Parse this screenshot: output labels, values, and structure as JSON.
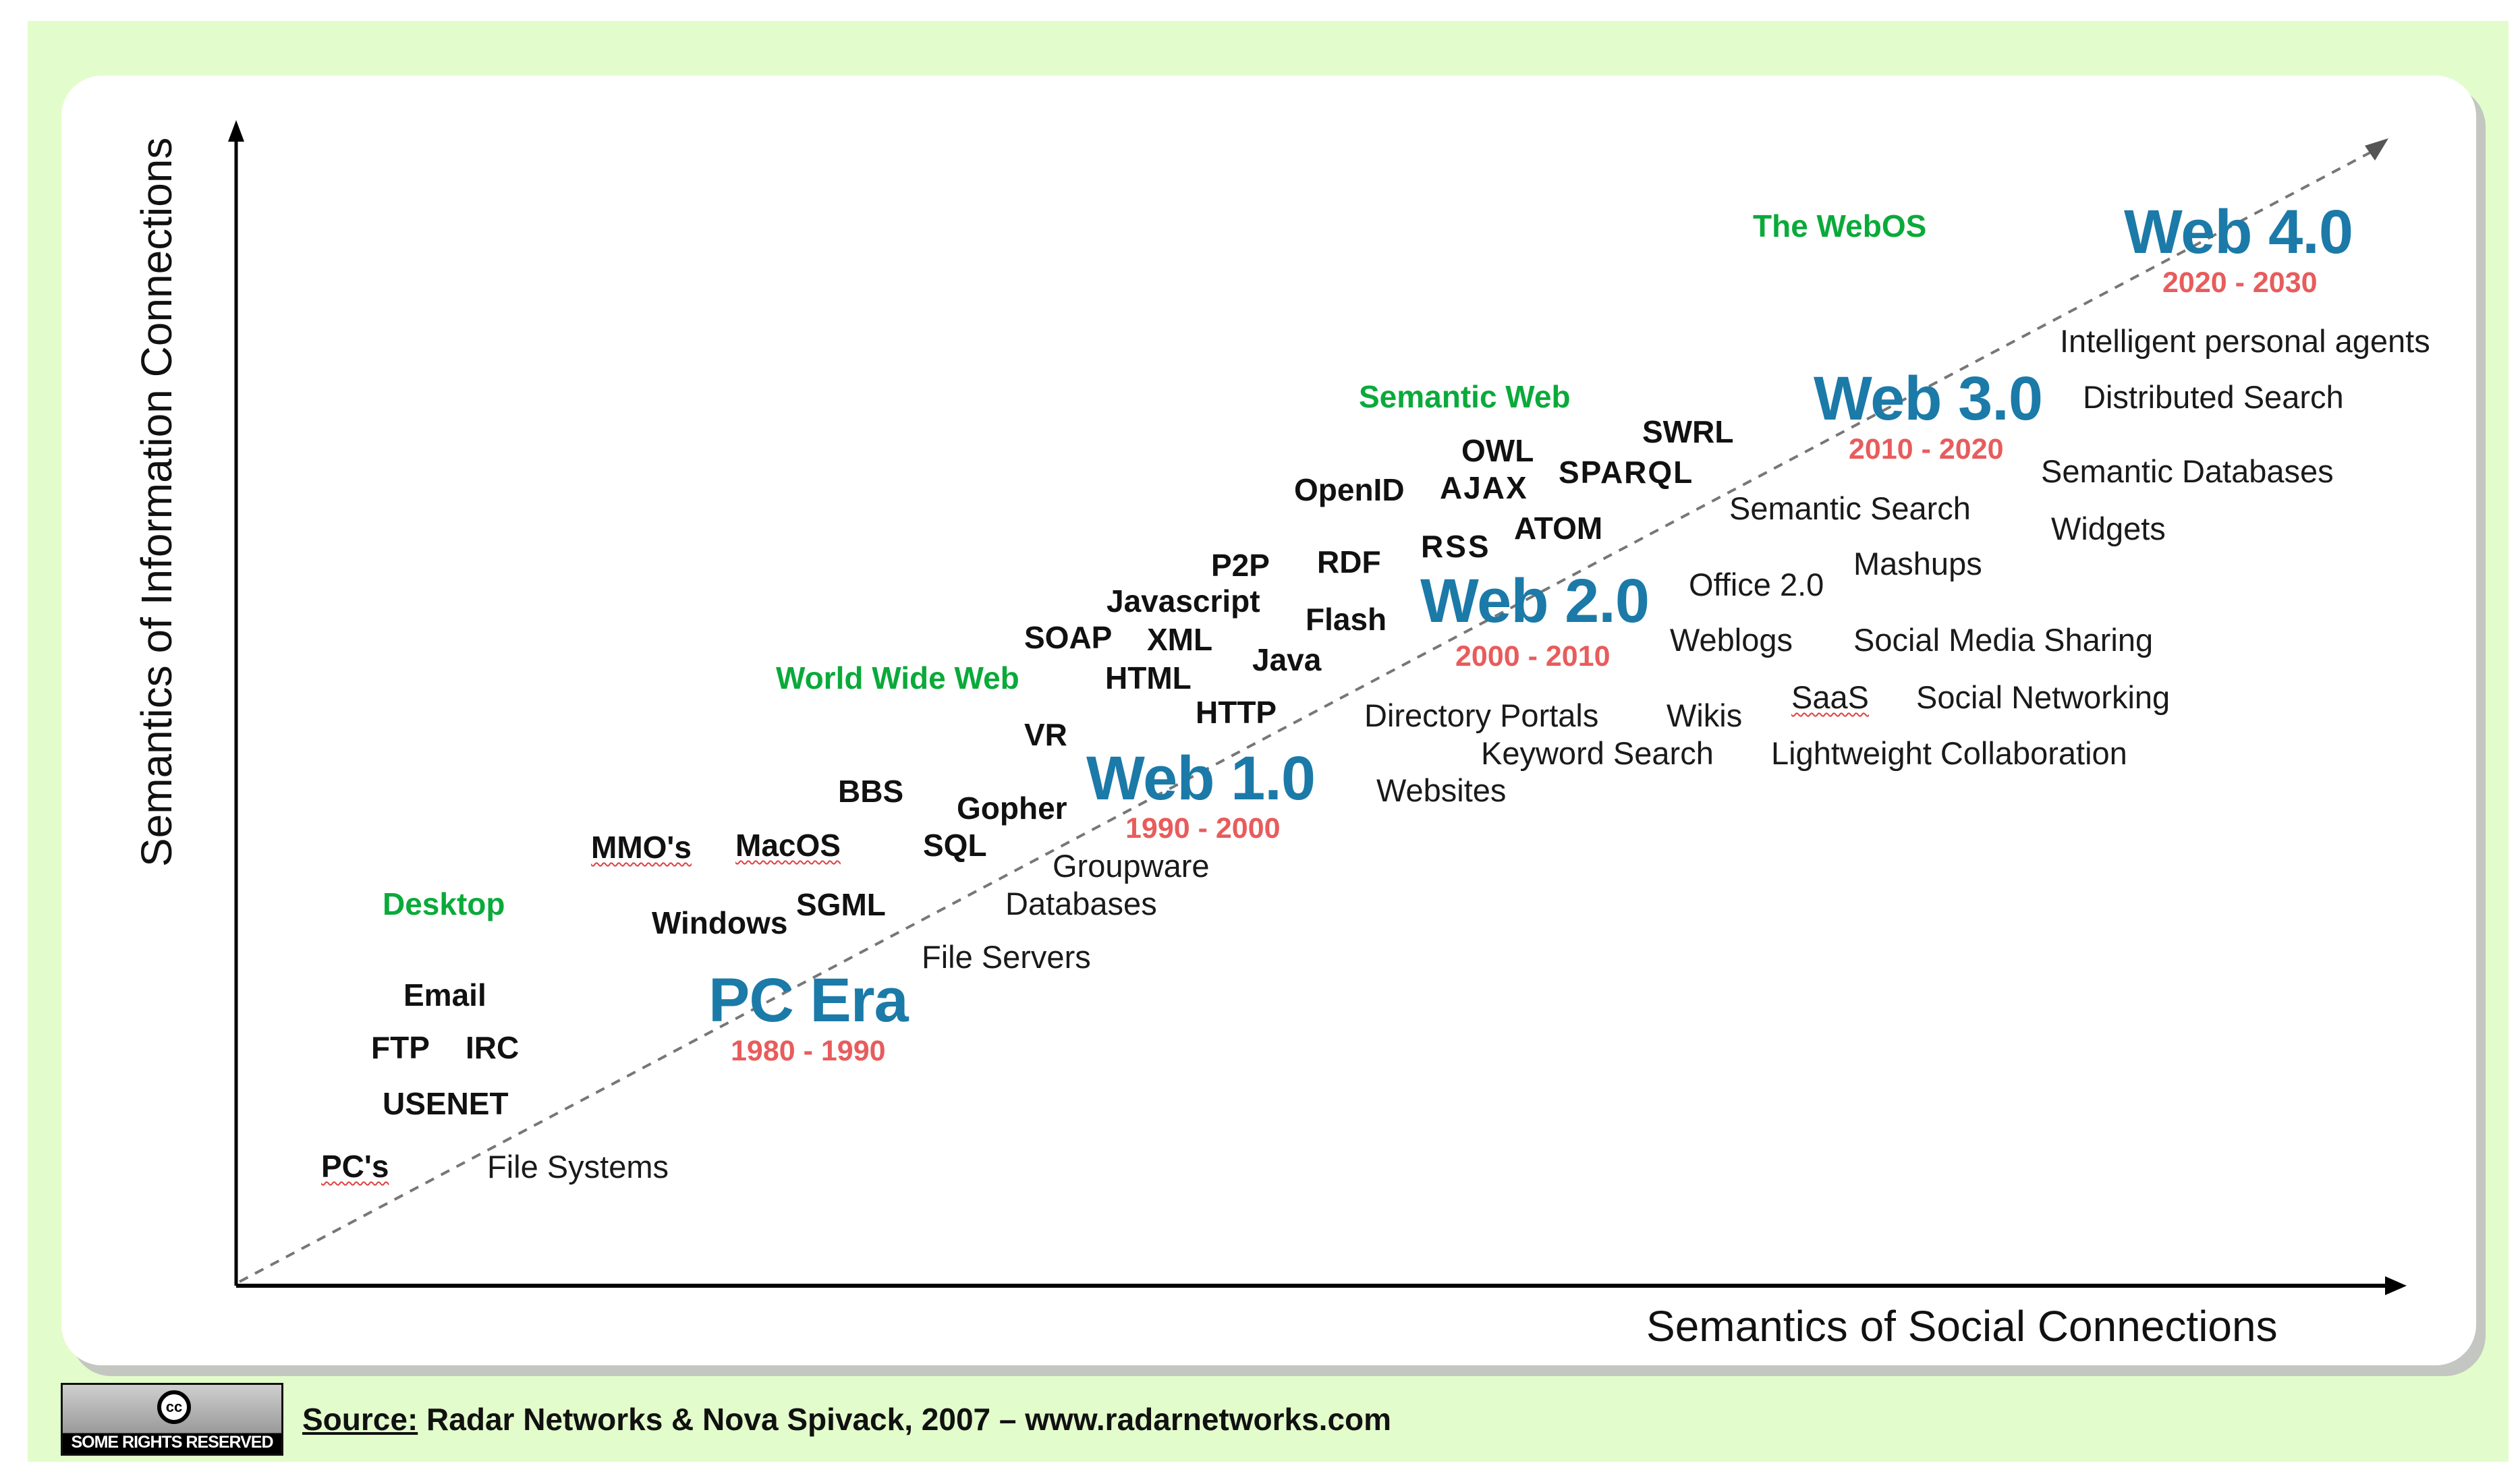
{
  "diagram": {
    "y_axis_title": "Semantics of Information Connections",
    "x_axis_title": "Semantics of Social Connections",
    "eras": [
      {
        "name": "PC Era",
        "years": "1980 - 1990"
      },
      {
        "name": "Web 1.0",
        "years": "1990 - 2000"
      },
      {
        "name": "Web 2.0",
        "years": "2000 - 2010"
      },
      {
        "name": "Web 3.0",
        "years": "2010 - 2020"
      },
      {
        "name": "Web 4.0",
        "years": "2020 - 2030"
      }
    ],
    "categories": [
      "Desktop",
      "World Wide Web",
      "Semantic Web",
      "The WebOS"
    ],
    "technologies": [
      "PC's",
      "USENET",
      "FTP",
      "IRC",
      "Email",
      "Windows",
      "SGML",
      "MMO's",
      "MacOS",
      "SQL",
      "BBS",
      "Gopher",
      "VR",
      "HTTP",
      "HTML",
      "Java",
      "SOAP",
      "XML",
      "Javascript",
      "Flash",
      "P2P",
      "RDF",
      "RSS",
      "ATOM",
      "OpenID",
      "AJAX",
      "OWL",
      "SPARQL",
      "SWRL"
    ],
    "applications": [
      "File Systems",
      "File Servers",
      "Databases",
      "Groupware",
      "Websites",
      "Keyword Search",
      "Directory Portals",
      "Wikis",
      "Lightweight Collaboration",
      "SaaS",
      "Social Networking",
      "Weblogs",
      "Social Media Sharing",
      "Office 2.0",
      "Mashups",
      "Semantic Search",
      "Widgets",
      "Semantic Databases",
      "Distributed Search",
      "Intelligent personal agents"
    ]
  },
  "footer": {
    "license_badge": "SOME RIGHTS RESERVED",
    "license_icon": "cc",
    "source_label": "Source:",
    "source_text": " Radar Networks & Nova Spivack, 2007 – www.radarnetworks.com"
  }
}
